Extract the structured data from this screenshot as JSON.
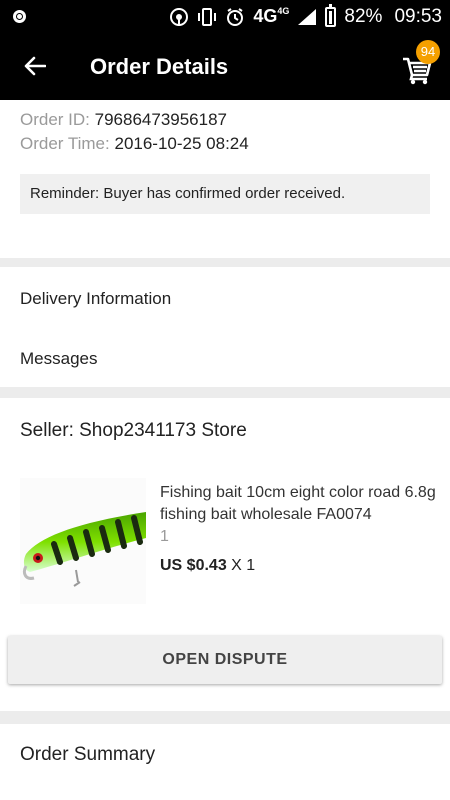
{
  "status_bar": {
    "network": "4G",
    "network_sup": "4G",
    "battery": "82%",
    "time": "09:53"
  },
  "app_bar": {
    "title": "Order Details",
    "cart_count": "94"
  },
  "order": {
    "id_label": "Order ID:",
    "id_value": "79686473956187",
    "time_label": "Order Time:",
    "time_value": "2016-10-25 08:24",
    "reminder": "Reminder: Buyer has confirmed order received."
  },
  "sections": {
    "delivery": "Delivery Information",
    "messages": "Messages"
  },
  "seller": {
    "label": "Seller: Shop2341173 Store"
  },
  "product": {
    "title": "Fishing bait 10cm eight color road 6.8g fishing bait wholesale FA0074",
    "variant": "1",
    "price": "US $0.43",
    "qty": "X 1"
  },
  "actions": {
    "open_dispute": "OPEN DISPUTE"
  },
  "summary": {
    "title": "Order Summary"
  },
  "colors": {
    "bar": "#000000",
    "badge": "#f5a000",
    "page_bg": "#ececec"
  }
}
